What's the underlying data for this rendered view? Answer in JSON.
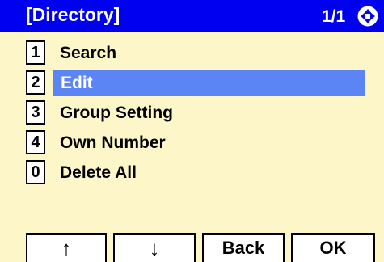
{
  "header": {
    "title": "[Directory]",
    "page_indicator": "1/1",
    "nav_icon": "four-way-navigation-icon"
  },
  "menu": {
    "items": [
      {
        "key": "1",
        "label": "Search",
        "selected": false
      },
      {
        "key": "2",
        "label": "Edit",
        "selected": true
      },
      {
        "key": "3",
        "label": "Group Setting",
        "selected": false
      },
      {
        "key": "4",
        "label": "Own Number",
        "selected": false
      },
      {
        "key": "0",
        "label": "Delete All",
        "selected": false
      }
    ]
  },
  "softkeys": {
    "up": "↑",
    "down": "↓",
    "back": "Back",
    "ok": "OK"
  },
  "colors": {
    "header_bg": "#0000f0",
    "screen_bg": "#fdf6c8",
    "selected_bg": "#5b84f4"
  }
}
